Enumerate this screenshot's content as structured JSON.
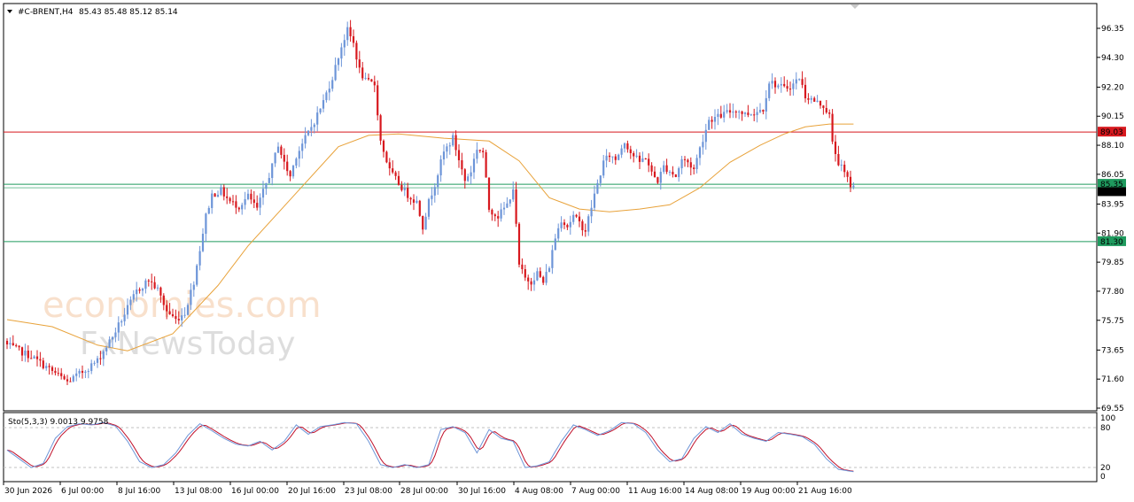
{
  "header": {
    "symbol": "#C-BRENT,H4",
    "ohlc": "85.43 85.48 85.12 85.14"
  },
  "indicator": {
    "label": "Sto(5,3,3) 9.0013 9.9758",
    "levels": [
      "100",
      "80",
      "20",
      "0"
    ]
  },
  "watermark": {
    "line1": "economies.com",
    "line2": "FxNewsToday"
  },
  "colors": {
    "bull": "#6d95d8",
    "bear": "#d7181e",
    "ma": "#e8a23a",
    "stoch_main": "#6d95d8",
    "stoch_signal": "#c0102a",
    "resistance": "#d7181e",
    "support": "#1f9a5e"
  },
  "chart_data": {
    "type": "candlestick",
    "instrument": "#C-BRENT",
    "timeframe": "H4",
    "ylim": [
      69.55,
      97.5
    ],
    "y_ticks": [
      "96.35",
      "94.30",
      "92.20",
      "90.15",
      "88.10",
      "86.05",
      "83.95",
      "81.90",
      "79.85",
      "77.80",
      "75.75",
      "73.65",
      "71.60",
      "69.55"
    ],
    "x_ticks": [
      "30 Jun 2026",
      "6 Jul 00:00",
      "8 Jul 16:00",
      "13 Jul 08:00",
      "16 Jul 00:00",
      "20 Jul 16:00",
      "23 Jul 08:00",
      "28 Jul 00:00",
      "30 Jul 16:00",
      "4 Aug 08:00",
      "7 Aug 00:00",
      "11 Aug 16:00",
      "14 Aug 08:00",
      "19 Aug 00:00",
      "21 Aug 16:00"
    ],
    "horizontal_lines": [
      {
        "value": 89.03,
        "label": "89.03",
        "color": "#d7181e"
      },
      {
        "value": 85.35,
        "label": "85.35",
        "color": "#1f9a5e"
      },
      {
        "value": 81.3,
        "label": "81.30",
        "color": "#1f9a5e"
      }
    ],
    "current_price": 85.14,
    "close_path": [
      [
        0,
        74.0
      ],
      [
        8,
        73.2
      ],
      [
        14,
        72.3
      ],
      [
        20,
        71.4
      ],
      [
        25,
        72.1
      ],
      [
        30,
        72.9
      ],
      [
        35,
        74.6
      ],
      [
        39,
        76.2
      ],
      [
        43,
        77.8
      ],
      [
        47,
        78.6
      ],
      [
        50,
        77.9
      ],
      [
        53,
        76.4
      ],
      [
        56,
        75.8
      ],
      [
        59,
        76.3
      ],
      [
        62,
        78.5
      ],
      [
        64,
        80.8
      ],
      [
        66,
        83.1
      ],
      [
        68,
        84.6
      ],
      [
        71,
        84.9
      ],
      [
        74,
        84.1
      ],
      [
        77,
        83.8
      ],
      [
        80,
        84.5
      ],
      [
        83,
        83.6
      ],
      [
        85,
        84.8
      ],
      [
        88,
        86.6
      ],
      [
        90,
        88.2
      ],
      [
        92,
        86.8
      ],
      [
        94,
        85.9
      ],
      [
        96,
        87.4
      ],
      [
        99,
        88.6
      ],
      [
        102,
        89.8
      ],
      [
        105,
        91.2
      ],
      [
        108,
        92.9
      ],
      [
        111,
        95.1
      ],
      [
        113,
        96.2
      ],
      [
        115,
        95.3
      ],
      [
        117,
        93.4
      ],
      [
        119,
        92.6
      ],
      [
        122,
        92.4
      ],
      [
        124,
        88.4
      ],
      [
        127,
        86.3
      ],
      [
        130,
        85.4
      ],
      [
        133,
        84.6
      ],
      [
        136,
        84.1
      ],
      [
        138,
        82.4
      ],
      [
        140,
        84.1
      ],
      [
        142,
        85.4
      ],
      [
        145,
        87.6
      ],
      [
        148,
        88.6
      ],
      [
        150,
        87.1
      ],
      [
        152,
        85.6
      ],
      [
        154,
        86.3
      ],
      [
        156,
        87.9
      ],
      [
        158,
        87.6
      ],
      [
        160,
        83.6
      ],
      [
        163,
        83.1
      ],
      [
        166,
        83.9
      ],
      [
        168,
        85.1
      ],
      [
        170,
        79.6
      ],
      [
        172,
        78.7
      ],
      [
        174,
        78.5
      ],
      [
        176,
        79.1
      ],
      [
        178,
        78.4
      ],
      [
        180,
        79.6
      ],
      [
        182,
        81.6
      ],
      [
        184,
        82.9
      ],
      [
        186,
        82.4
      ],
      [
        188,
        83.1
      ],
      [
        190,
        82.6
      ],
      [
        192,
        82.1
      ],
      [
        195,
        84.6
      ],
      [
        198,
        86.9
      ],
      [
        200,
        87.4
      ],
      [
        202,
        87.1
      ],
      [
        205,
        88.4
      ],
      [
        207,
        87.6
      ],
      [
        210,
        86.9
      ],
      [
        212,
        87.3
      ],
      [
        214,
        86.1
      ],
      [
        216,
        85.6
      ],
      [
        218,
        86.6
      ],
      [
        220,
        86.3
      ],
      [
        222,
        85.9
      ],
      [
        224,
        87.1
      ],
      [
        226,
        86.9
      ],
      [
        228,
        86.4
      ],
      [
        230,
        87.9
      ],
      [
        233,
        89.9
      ],
      [
        236,
        90.1
      ],
      [
        239,
        90.4
      ],
      [
        242,
        90.6
      ],
      [
        245,
        90.3
      ],
      [
        248,
        90.4
      ],
      [
        251,
        90.7
      ],
      [
        253,
        92.6
      ],
      [
        255,
        92.4
      ],
      [
        258,
        92.1
      ],
      [
        261,
        92.4
      ],
      [
        263,
        92.9
      ],
      [
        265,
        91.6
      ],
      [
        268,
        91.2
      ],
      [
        271,
        90.9
      ],
      [
        273,
        90.2
      ],
      [
        274,
        88.2
      ],
      [
        276,
        86.9
      ],
      [
        278,
        86.1
      ],
      [
        280,
        85.3
      ],
      [
        281,
        85.14
      ]
    ],
    "moving_average_path": [
      [
        0,
        75.8
      ],
      [
        15,
        75.3
      ],
      [
        30,
        74.0
      ],
      [
        40,
        73.6
      ],
      [
        55,
        74.8
      ],
      [
        70,
        78.2
      ],
      [
        80,
        81.0
      ],
      [
        95,
        84.5
      ],
      [
        110,
        88.0
      ],
      [
        120,
        88.8
      ],
      [
        130,
        88.9
      ],
      [
        145,
        88.6
      ],
      [
        160,
        88.4
      ],
      [
        170,
        87.0
      ],
      [
        180,
        84.4
      ],
      [
        190,
        83.6
      ],
      [
        200,
        83.4
      ],
      [
        210,
        83.6
      ],
      [
        220,
        83.9
      ],
      [
        230,
        85.1
      ],
      [
        240,
        86.9
      ],
      [
        250,
        88.1
      ],
      [
        258,
        88.9
      ],
      [
        265,
        89.4
      ],
      [
        273,
        89.6
      ],
      [
        281,
        89.6
      ]
    ],
    "stochastic_path": [
      [
        0,
        45
      ],
      [
        4,
        30
      ],
      [
        8,
        15
      ],
      [
        12,
        22
      ],
      [
        16,
        65
      ],
      [
        20,
        85
      ],
      [
        24,
        90
      ],
      [
        28,
        88
      ],
      [
        32,
        92
      ],
      [
        36,
        86
      ],
      [
        40,
        60
      ],
      [
        44,
        25
      ],
      [
        48,
        15
      ],
      [
        52,
        20
      ],
      [
        56,
        40
      ],
      [
        60,
        70
      ],
      [
        64,
        90
      ],
      [
        68,
        78
      ],
      [
        72,
        65
      ],
      [
        76,
        55
      ],
      [
        80,
        52
      ],
      [
        84,
        60
      ],
      [
        88,
        45
      ],
      [
        92,
        60
      ],
      [
        96,
        88
      ],
      [
        100,
        72
      ],
      [
        104,
        85
      ],
      [
        108,
        88
      ],
      [
        112,
        92
      ],
      [
        116,
        90
      ],
      [
        120,
        60
      ],
      [
        124,
        20
      ],
      [
        128,
        15
      ],
      [
        132,
        20
      ],
      [
        136,
        15
      ],
      [
        140,
        20
      ],
      [
        144,
        80
      ],
      [
        148,
        85
      ],
      [
        152,
        75
      ],
      [
        156,
        40
      ],
      [
        160,
        80
      ],
      [
        164,
        65
      ],
      [
        168,
        60
      ],
      [
        172,
        15
      ],
      [
        176,
        18
      ],
      [
        180,
        25
      ],
      [
        184,
        60
      ],
      [
        188,
        88
      ],
      [
        192,
        80
      ],
      [
        196,
        70
      ],
      [
        200,
        78
      ],
      [
        204,
        92
      ],
      [
        208,
        90
      ],
      [
        212,
        75
      ],
      [
        216,
        45
      ],
      [
        220,
        25
      ],
      [
        224,
        30
      ],
      [
        228,
        65
      ],
      [
        232,
        85
      ],
      [
        236,
        75
      ],
      [
        240,
        90
      ],
      [
        244,
        72
      ],
      [
        248,
        65
      ],
      [
        252,
        60
      ],
      [
        256,
        75
      ],
      [
        260,
        72
      ],
      [
        264,
        68
      ],
      [
        268,
        55
      ],
      [
        272,
        30
      ],
      [
        276,
        12
      ],
      [
        281,
        8
      ]
    ]
  }
}
